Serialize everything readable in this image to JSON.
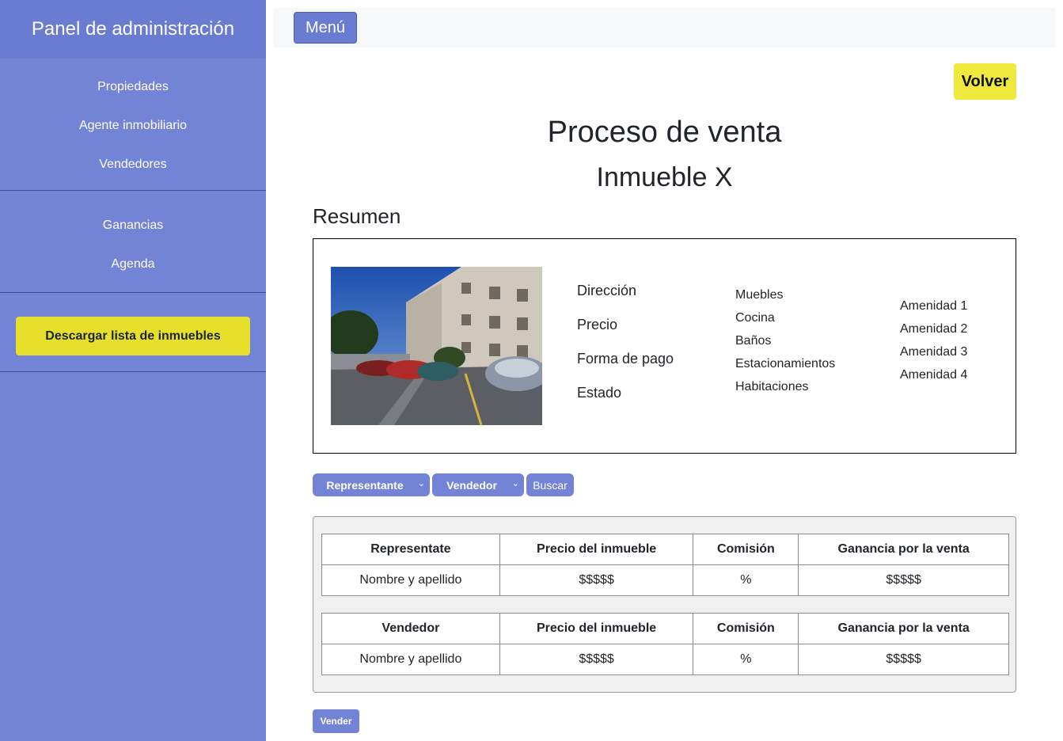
{
  "sidebar": {
    "title": "Panel de administración",
    "items": [
      {
        "label": "Propiedades"
      },
      {
        "label": "Agente inmobiliario"
      },
      {
        "label": "Vendedores"
      },
      {
        "label": "Ganancias"
      },
      {
        "label": "Agenda"
      }
    ],
    "download_label": "Descargar lista de inmuebles"
  },
  "topbar": {
    "menu_label": "Menú"
  },
  "back_label": "Volver",
  "page": {
    "title": "Proceso de venta",
    "subtitle": "Inmueble X",
    "summary_heading": "Resumen"
  },
  "summary": {
    "details": [
      "Dirección",
      "Precio",
      "Forma de pago",
      "Estado"
    ],
    "features": [
      "Muebles",
      "Cocina",
      "Baños",
      "Estacionamientos",
      "Habitaciones"
    ],
    "amenities": [
      "Amenidad 1",
      "Amenidad 2",
      "Amenidad 3",
      "Amenidad 4"
    ]
  },
  "filters": {
    "representante": "Representante",
    "vendedor": "Vendedor",
    "search_label": "Buscar"
  },
  "tables": [
    {
      "headers": [
        "Representate",
        "Precio del inmueble",
        "Comisión",
        "Ganancia por la venta"
      ],
      "row": [
        "Nombre y apellido",
        "$$$$$",
        "%",
        "$$$$$"
      ]
    },
    {
      "headers": [
        "Vendedor",
        "Precio del inmueble",
        "Comisión",
        "Ganancia por la venta"
      ],
      "row": [
        "Nombre y apellido",
        "$$$$$",
        "%",
        "$$$$$"
      ]
    }
  ],
  "sell_label": "Vender",
  "colors": {
    "sidebar": "#7383d6",
    "accent_yellow": "#e6df2b",
    "button_blue": "#6a7bd2"
  }
}
